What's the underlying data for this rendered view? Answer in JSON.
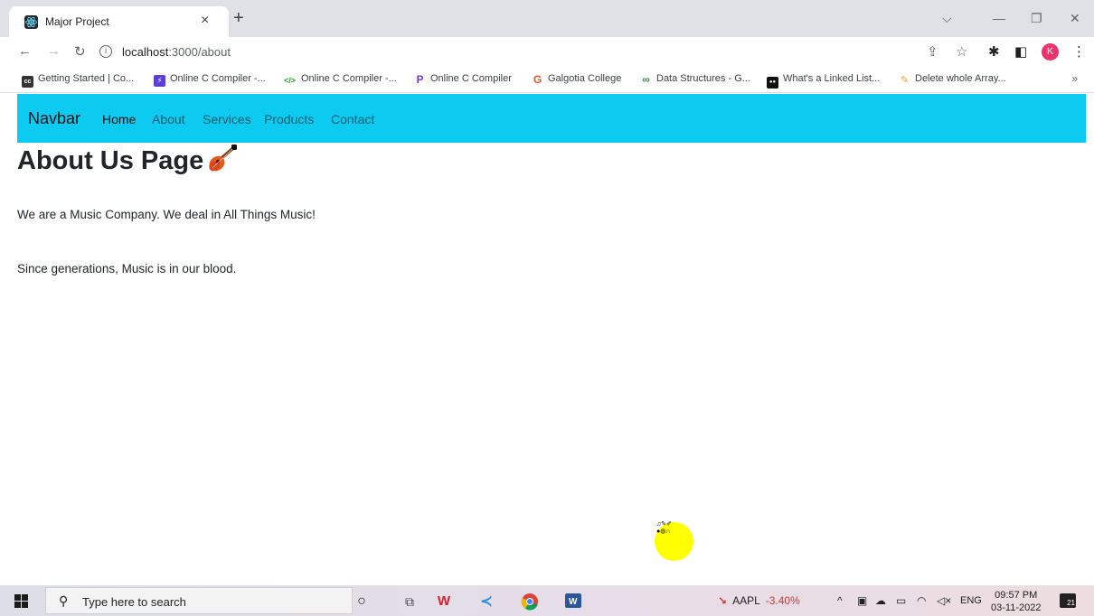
{
  "browser": {
    "tab_title": "Major Project",
    "tab_close": "×",
    "new_tab": "+",
    "url_host": "localhost",
    "url_path": ":3000/about",
    "profile_initial": "K",
    "window_controls": {
      "dropdown": "⌵",
      "minimize": "—",
      "restore": "❐",
      "close": "✕"
    }
  },
  "bookmarks": [
    {
      "label": "Getting Started | Co...",
      "icon": "cc",
      "color": "#333333"
    },
    {
      "label": "Online C Compiler -...",
      "icon": "⚡",
      "color": "#5b3fd6"
    },
    {
      "label": "Online C Compiler -...",
      "icon": "</>",
      "color": "#2e9d2e"
    },
    {
      "label": "Online C Compiler",
      "icon": "P",
      "color": "#7c3aed"
    },
    {
      "label": "Galgotia College",
      "icon": "G",
      "color": "#e5591b"
    },
    {
      "label": "Data Structures - G...",
      "icon": "∞",
      "color": "#2f8d46"
    },
    {
      "label": "What's a Linked List...",
      "icon": "●●",
      "color": "#111111"
    },
    {
      "label": "Delete whole Array...",
      "icon": "✎",
      "color": "#f0a020"
    }
  ],
  "bookmarks_more": "»",
  "navbar": {
    "brand": "Navbar",
    "links": [
      "Home",
      "About",
      "Services",
      "Products",
      "Contact"
    ]
  },
  "page": {
    "title": "About Us Page",
    "paragraphs": [
      "We are a Music Company. We deal in All Things Music!",
      "Since generations, Music is in our blood."
    ]
  },
  "cursor_glyphs": [
    "♫✎✐",
    "●◍∩"
  ],
  "taskbar": {
    "search_placeholder": "Type here to search",
    "stock_symbol": "AAPL",
    "stock_change": "-3.40%",
    "language": "ENG",
    "time": "09:57 PM",
    "date": "03-11-2022",
    "notification_count": "21"
  },
  "colors": {
    "navbar_bg": "#0dcaf0",
    "stock_negative": "#d13438",
    "cursor_highlight": "#ffff00"
  }
}
